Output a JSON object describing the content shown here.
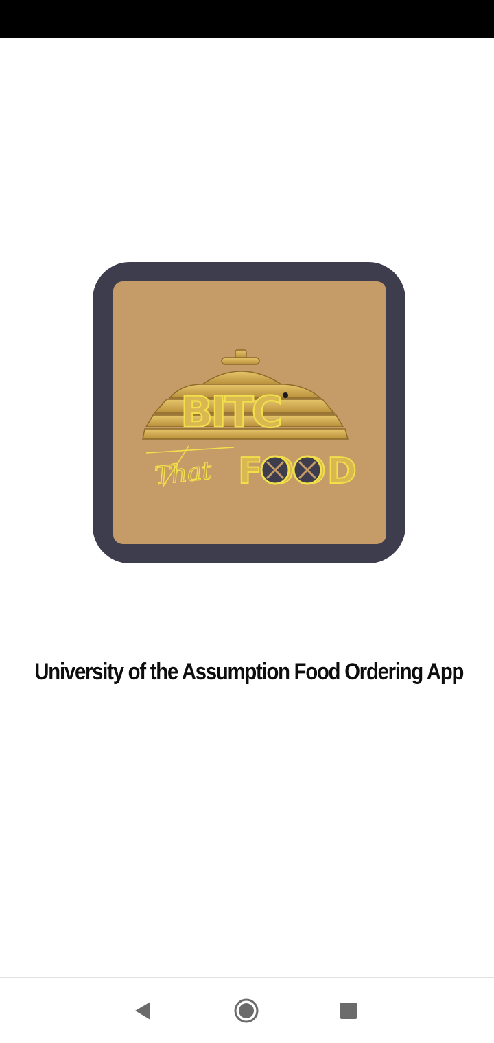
{
  "status_bar": {},
  "logo": {
    "word_top": "BITC",
    "word_script": "That",
    "word_bottom": "FOOD",
    "colors": {
      "frame": "#3e3d4e",
      "background": "#c59c68",
      "gold": "#d8b24a",
      "gold_outline": "#f2e04a"
    }
  },
  "splash": {
    "title": "University of the Assumption Food Ordering App"
  },
  "navigation": {
    "back_icon": "triangle-back-icon",
    "home_icon": "circle-home-icon",
    "recents_icon": "square-recents-icon"
  }
}
